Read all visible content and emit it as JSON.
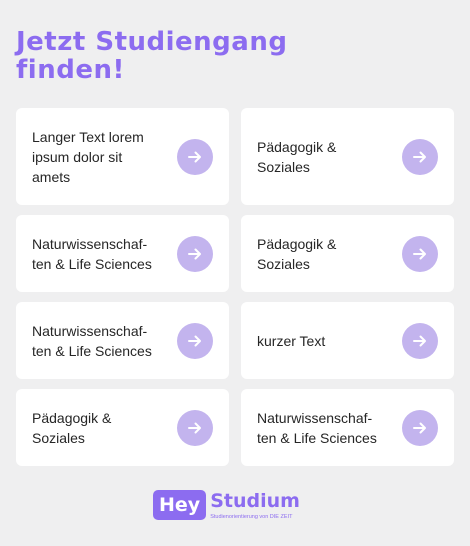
{
  "heading": "Jetzt Studiengang finden!",
  "cards": [
    {
      "label": "Langer Text lorem ipsum dolor sit amets"
    },
    {
      "label": "Pädagogik & Soziales"
    },
    {
      "label": "Naturwissenschaf-ten & Life Sciences"
    },
    {
      "label": "Pädagogik & Soziales"
    },
    {
      "label": "Naturwissenschaf-ten & Life Sciences"
    },
    {
      "label": "kurzer Text"
    },
    {
      "label": "Pädagogik & Soziales"
    },
    {
      "label": "Naturwissenschaf-ten & Life Sciences"
    }
  ],
  "card_icon": "arrow-right-icon",
  "logo": {
    "hey": "Hey",
    "studium": "Studium",
    "subline": "Studienorientierung von DIE ZEIT"
  },
  "colors": {
    "accent": "#8c6cf0",
    "button": "#c3b4ee",
    "background": "#efeff0",
    "card": "#ffffff"
  }
}
